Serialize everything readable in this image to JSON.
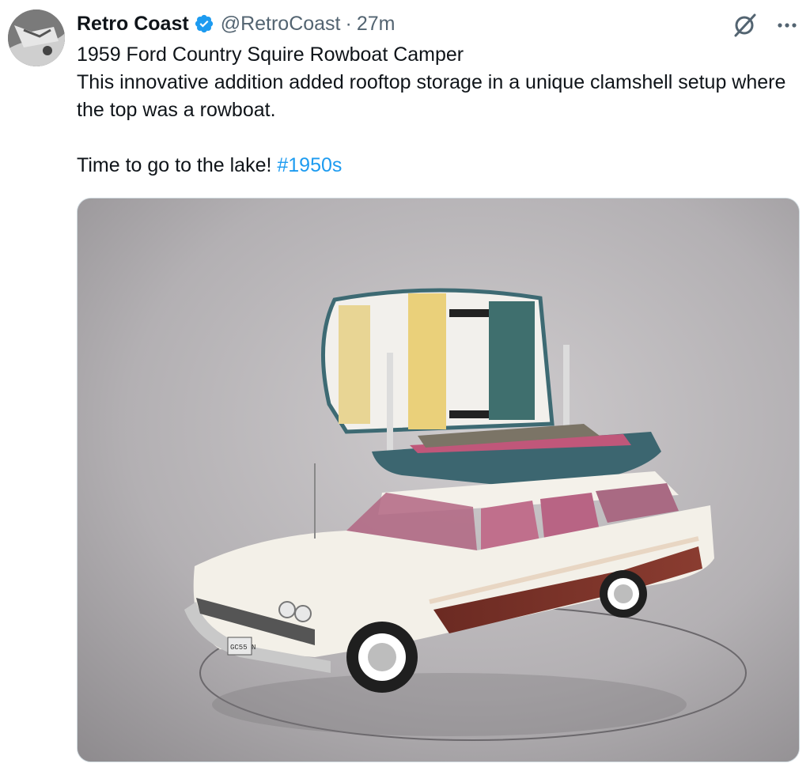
{
  "tweet": {
    "author_name": "Retro Coast",
    "handle": "@RetroCoast",
    "separator": "·",
    "time": "27m",
    "text_line1": "1959 Ford Country Squire Rowboat Camper",
    "text_line2": "This innovative addition added rooftop storage in a unique clamshell setup where the top was a rowboat.",
    "text_line3": "Time to go to the lake! ",
    "hashtag": "#1950s",
    "verified": true
  },
  "media": {
    "plate_text": "GC55 N"
  },
  "icons": {
    "verified": "verified-badge-icon",
    "grok": "grok-icon",
    "more": "more-icon"
  },
  "colors": {
    "link": "#1d9bf0",
    "verified": "#1d9bf0",
    "muted": "#536471"
  }
}
